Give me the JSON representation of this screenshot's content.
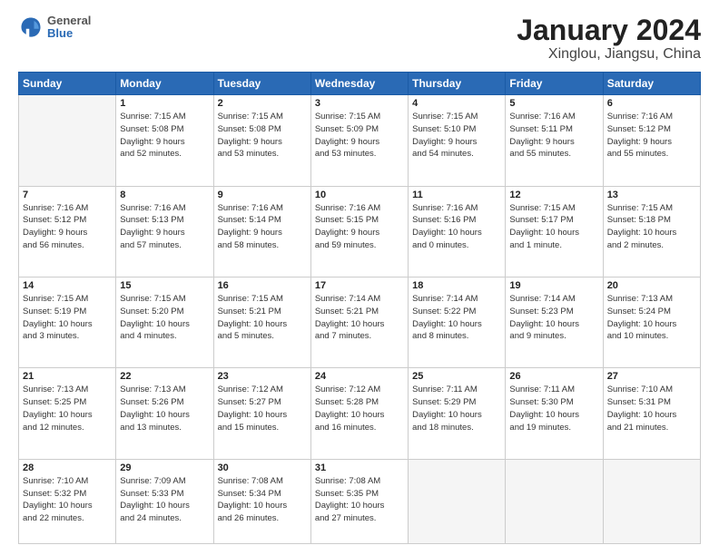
{
  "header": {
    "logo": {
      "general": "General",
      "blue": "Blue"
    },
    "title": "January 2024",
    "subtitle": "Xinglou, Jiangsu, China"
  },
  "calendar": {
    "days_of_week": [
      "Sunday",
      "Monday",
      "Tuesday",
      "Wednesday",
      "Thursday",
      "Friday",
      "Saturday"
    ],
    "weeks": [
      [
        {
          "num": "",
          "info": ""
        },
        {
          "num": "1",
          "info": "Sunrise: 7:15 AM\nSunset: 5:08 PM\nDaylight: 9 hours\nand 52 minutes."
        },
        {
          "num": "2",
          "info": "Sunrise: 7:15 AM\nSunset: 5:08 PM\nDaylight: 9 hours\nand 53 minutes."
        },
        {
          "num": "3",
          "info": "Sunrise: 7:15 AM\nSunset: 5:09 PM\nDaylight: 9 hours\nand 53 minutes."
        },
        {
          "num": "4",
          "info": "Sunrise: 7:15 AM\nSunset: 5:10 PM\nDaylight: 9 hours\nand 54 minutes."
        },
        {
          "num": "5",
          "info": "Sunrise: 7:16 AM\nSunset: 5:11 PM\nDaylight: 9 hours\nand 55 minutes."
        },
        {
          "num": "6",
          "info": "Sunrise: 7:16 AM\nSunset: 5:12 PM\nDaylight: 9 hours\nand 55 minutes."
        }
      ],
      [
        {
          "num": "7",
          "info": "Sunrise: 7:16 AM\nSunset: 5:12 PM\nDaylight: 9 hours\nand 56 minutes."
        },
        {
          "num": "8",
          "info": "Sunrise: 7:16 AM\nSunset: 5:13 PM\nDaylight: 9 hours\nand 57 minutes."
        },
        {
          "num": "9",
          "info": "Sunrise: 7:16 AM\nSunset: 5:14 PM\nDaylight: 9 hours\nand 58 minutes."
        },
        {
          "num": "10",
          "info": "Sunrise: 7:16 AM\nSunset: 5:15 PM\nDaylight: 9 hours\nand 59 minutes."
        },
        {
          "num": "11",
          "info": "Sunrise: 7:16 AM\nSunset: 5:16 PM\nDaylight: 10 hours\nand 0 minutes."
        },
        {
          "num": "12",
          "info": "Sunrise: 7:15 AM\nSunset: 5:17 PM\nDaylight: 10 hours\nand 1 minute."
        },
        {
          "num": "13",
          "info": "Sunrise: 7:15 AM\nSunset: 5:18 PM\nDaylight: 10 hours\nand 2 minutes."
        }
      ],
      [
        {
          "num": "14",
          "info": "Sunrise: 7:15 AM\nSunset: 5:19 PM\nDaylight: 10 hours\nand 3 minutes."
        },
        {
          "num": "15",
          "info": "Sunrise: 7:15 AM\nSunset: 5:20 PM\nDaylight: 10 hours\nand 4 minutes."
        },
        {
          "num": "16",
          "info": "Sunrise: 7:15 AM\nSunset: 5:21 PM\nDaylight: 10 hours\nand 5 minutes."
        },
        {
          "num": "17",
          "info": "Sunrise: 7:14 AM\nSunset: 5:21 PM\nDaylight: 10 hours\nand 7 minutes."
        },
        {
          "num": "18",
          "info": "Sunrise: 7:14 AM\nSunset: 5:22 PM\nDaylight: 10 hours\nand 8 minutes."
        },
        {
          "num": "19",
          "info": "Sunrise: 7:14 AM\nSunset: 5:23 PM\nDaylight: 10 hours\nand 9 minutes."
        },
        {
          "num": "20",
          "info": "Sunrise: 7:13 AM\nSunset: 5:24 PM\nDaylight: 10 hours\nand 10 minutes."
        }
      ],
      [
        {
          "num": "21",
          "info": "Sunrise: 7:13 AM\nSunset: 5:25 PM\nDaylight: 10 hours\nand 12 minutes."
        },
        {
          "num": "22",
          "info": "Sunrise: 7:13 AM\nSunset: 5:26 PM\nDaylight: 10 hours\nand 13 minutes."
        },
        {
          "num": "23",
          "info": "Sunrise: 7:12 AM\nSunset: 5:27 PM\nDaylight: 10 hours\nand 15 minutes."
        },
        {
          "num": "24",
          "info": "Sunrise: 7:12 AM\nSunset: 5:28 PM\nDaylight: 10 hours\nand 16 minutes."
        },
        {
          "num": "25",
          "info": "Sunrise: 7:11 AM\nSunset: 5:29 PM\nDaylight: 10 hours\nand 18 minutes."
        },
        {
          "num": "26",
          "info": "Sunrise: 7:11 AM\nSunset: 5:30 PM\nDaylight: 10 hours\nand 19 minutes."
        },
        {
          "num": "27",
          "info": "Sunrise: 7:10 AM\nSunset: 5:31 PM\nDaylight: 10 hours\nand 21 minutes."
        }
      ],
      [
        {
          "num": "28",
          "info": "Sunrise: 7:10 AM\nSunset: 5:32 PM\nDaylight: 10 hours\nand 22 minutes."
        },
        {
          "num": "29",
          "info": "Sunrise: 7:09 AM\nSunset: 5:33 PM\nDaylight: 10 hours\nand 24 minutes."
        },
        {
          "num": "30",
          "info": "Sunrise: 7:08 AM\nSunset: 5:34 PM\nDaylight: 10 hours\nand 26 minutes."
        },
        {
          "num": "31",
          "info": "Sunrise: 7:08 AM\nSunset: 5:35 PM\nDaylight: 10 hours\nand 27 minutes."
        },
        {
          "num": "",
          "info": ""
        },
        {
          "num": "",
          "info": ""
        },
        {
          "num": "",
          "info": ""
        }
      ]
    ]
  }
}
